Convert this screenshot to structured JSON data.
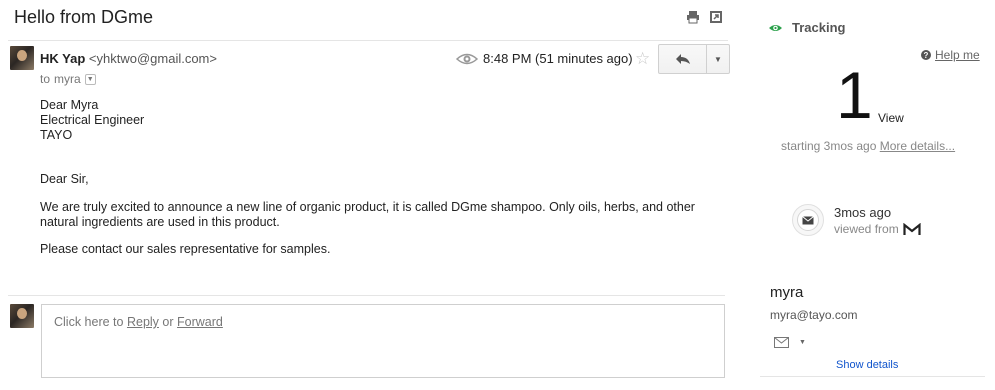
{
  "email": {
    "subject": "Hello from DGme",
    "sender_name": "HK Yap",
    "sender_email": "<yhktwo@gmail.com>",
    "to_prefix": "to",
    "to_name": "myra",
    "time": "8:48 PM (51 minutes ago)",
    "icons": [
      "print-icon",
      "new-window-icon",
      "eye-icon",
      "star-icon",
      "reply-icon",
      "chevron-down-icon"
    ],
    "body": {
      "greeting_lines": [
        "Dear Myra",
        "Electrical Engineer",
        "TAYO"
      ],
      "salutation": "Dear Sir,",
      "paragraph1": "We are truly excited to announce a new line of organic product, it is called DGme shampoo. Only oils, herbs, and other natural ingredients are used in this product.",
      "paragraph2": "Please contact our sales representative for samples."
    }
  },
  "reply_box": {
    "prefix": "Click here to",
    "reply_link": "Reply",
    "or_text": "or",
    "forward_link": "Forward"
  },
  "tracking": {
    "title": "Tracking",
    "help_label": "Help me",
    "views_count": "1",
    "views_label": "View",
    "starting_text": "starting 3mos ago",
    "more_details": "More details...",
    "last_view_ago": "3mos ago",
    "viewed_from": "viewed from",
    "accent_color": "#2aa04a",
    "icons": [
      "eye-icon",
      "help-icon",
      "mail-icon",
      "gmail-icon"
    ]
  },
  "contact": {
    "name": "myra",
    "email": "myra@tayo.com",
    "show_details": "Show details"
  }
}
